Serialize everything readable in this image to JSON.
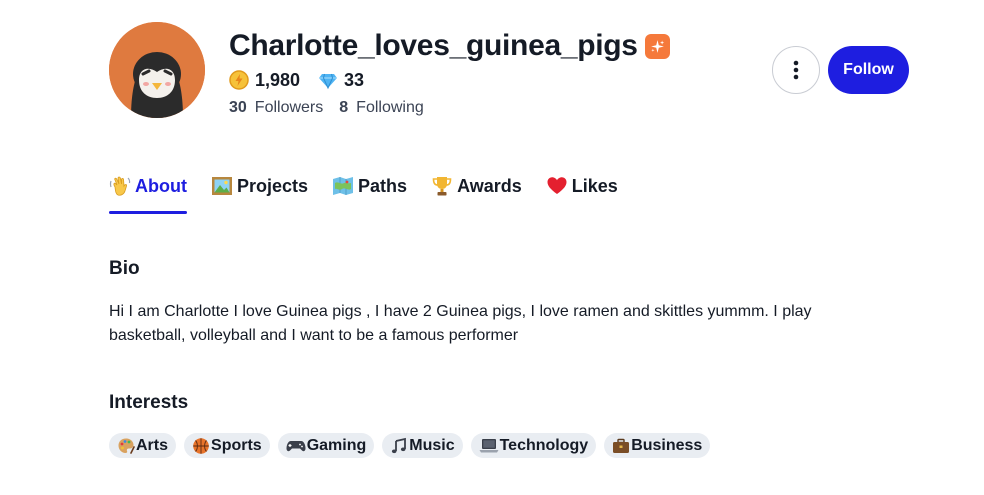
{
  "profile": {
    "username": "Charlotte_loves_guinea_pigs",
    "avatar_icon": "penguin-avatar",
    "badge_icon": "sparkle-badge-icon",
    "xp": "1,980",
    "xp_icon": "lightning-coin-icon",
    "gems": "33",
    "gems_icon": "diamond-icon",
    "followers_count": "30",
    "followers_label": "Followers",
    "following_count": "8",
    "following_label": "Following"
  },
  "actions": {
    "more_icon": "vertical-dots-icon",
    "follow_label": "Follow"
  },
  "tabs": [
    {
      "label": "About",
      "icon": "waving-hand-icon",
      "active": true
    },
    {
      "label": "Projects",
      "icon": "framed-picture-icon",
      "active": false
    },
    {
      "label": "Paths",
      "icon": "map-icon",
      "active": false
    },
    {
      "label": "Awards",
      "icon": "trophy-icon",
      "active": false
    },
    {
      "label": "Likes",
      "icon": "heart-icon",
      "active": false
    }
  ],
  "bio": {
    "title": "Bio",
    "text": "Hi I am Charlotte I love Guinea pigs , I have 2 Guinea pigs, I love ramen and skittles yummm. I play basketball, volleyball and I want to be a famous performer"
  },
  "interests": {
    "title": "Interests",
    "items": [
      {
        "label": "Arts",
        "icon": "palette-icon"
      },
      {
        "label": "Sports",
        "icon": "basketball-icon"
      },
      {
        "label": "Gaming",
        "icon": "game-controller-icon"
      },
      {
        "label": "Music",
        "icon": "music-note-icon"
      },
      {
        "label": "Technology",
        "icon": "laptop-icon"
      },
      {
        "label": "Business",
        "icon": "briefcase-icon"
      }
    ]
  },
  "colors": {
    "accent": "#1e1ee0",
    "avatar_bg": "#df7a3f",
    "badge_bg": "#f5793b",
    "chip_bg": "#e9edf2"
  }
}
